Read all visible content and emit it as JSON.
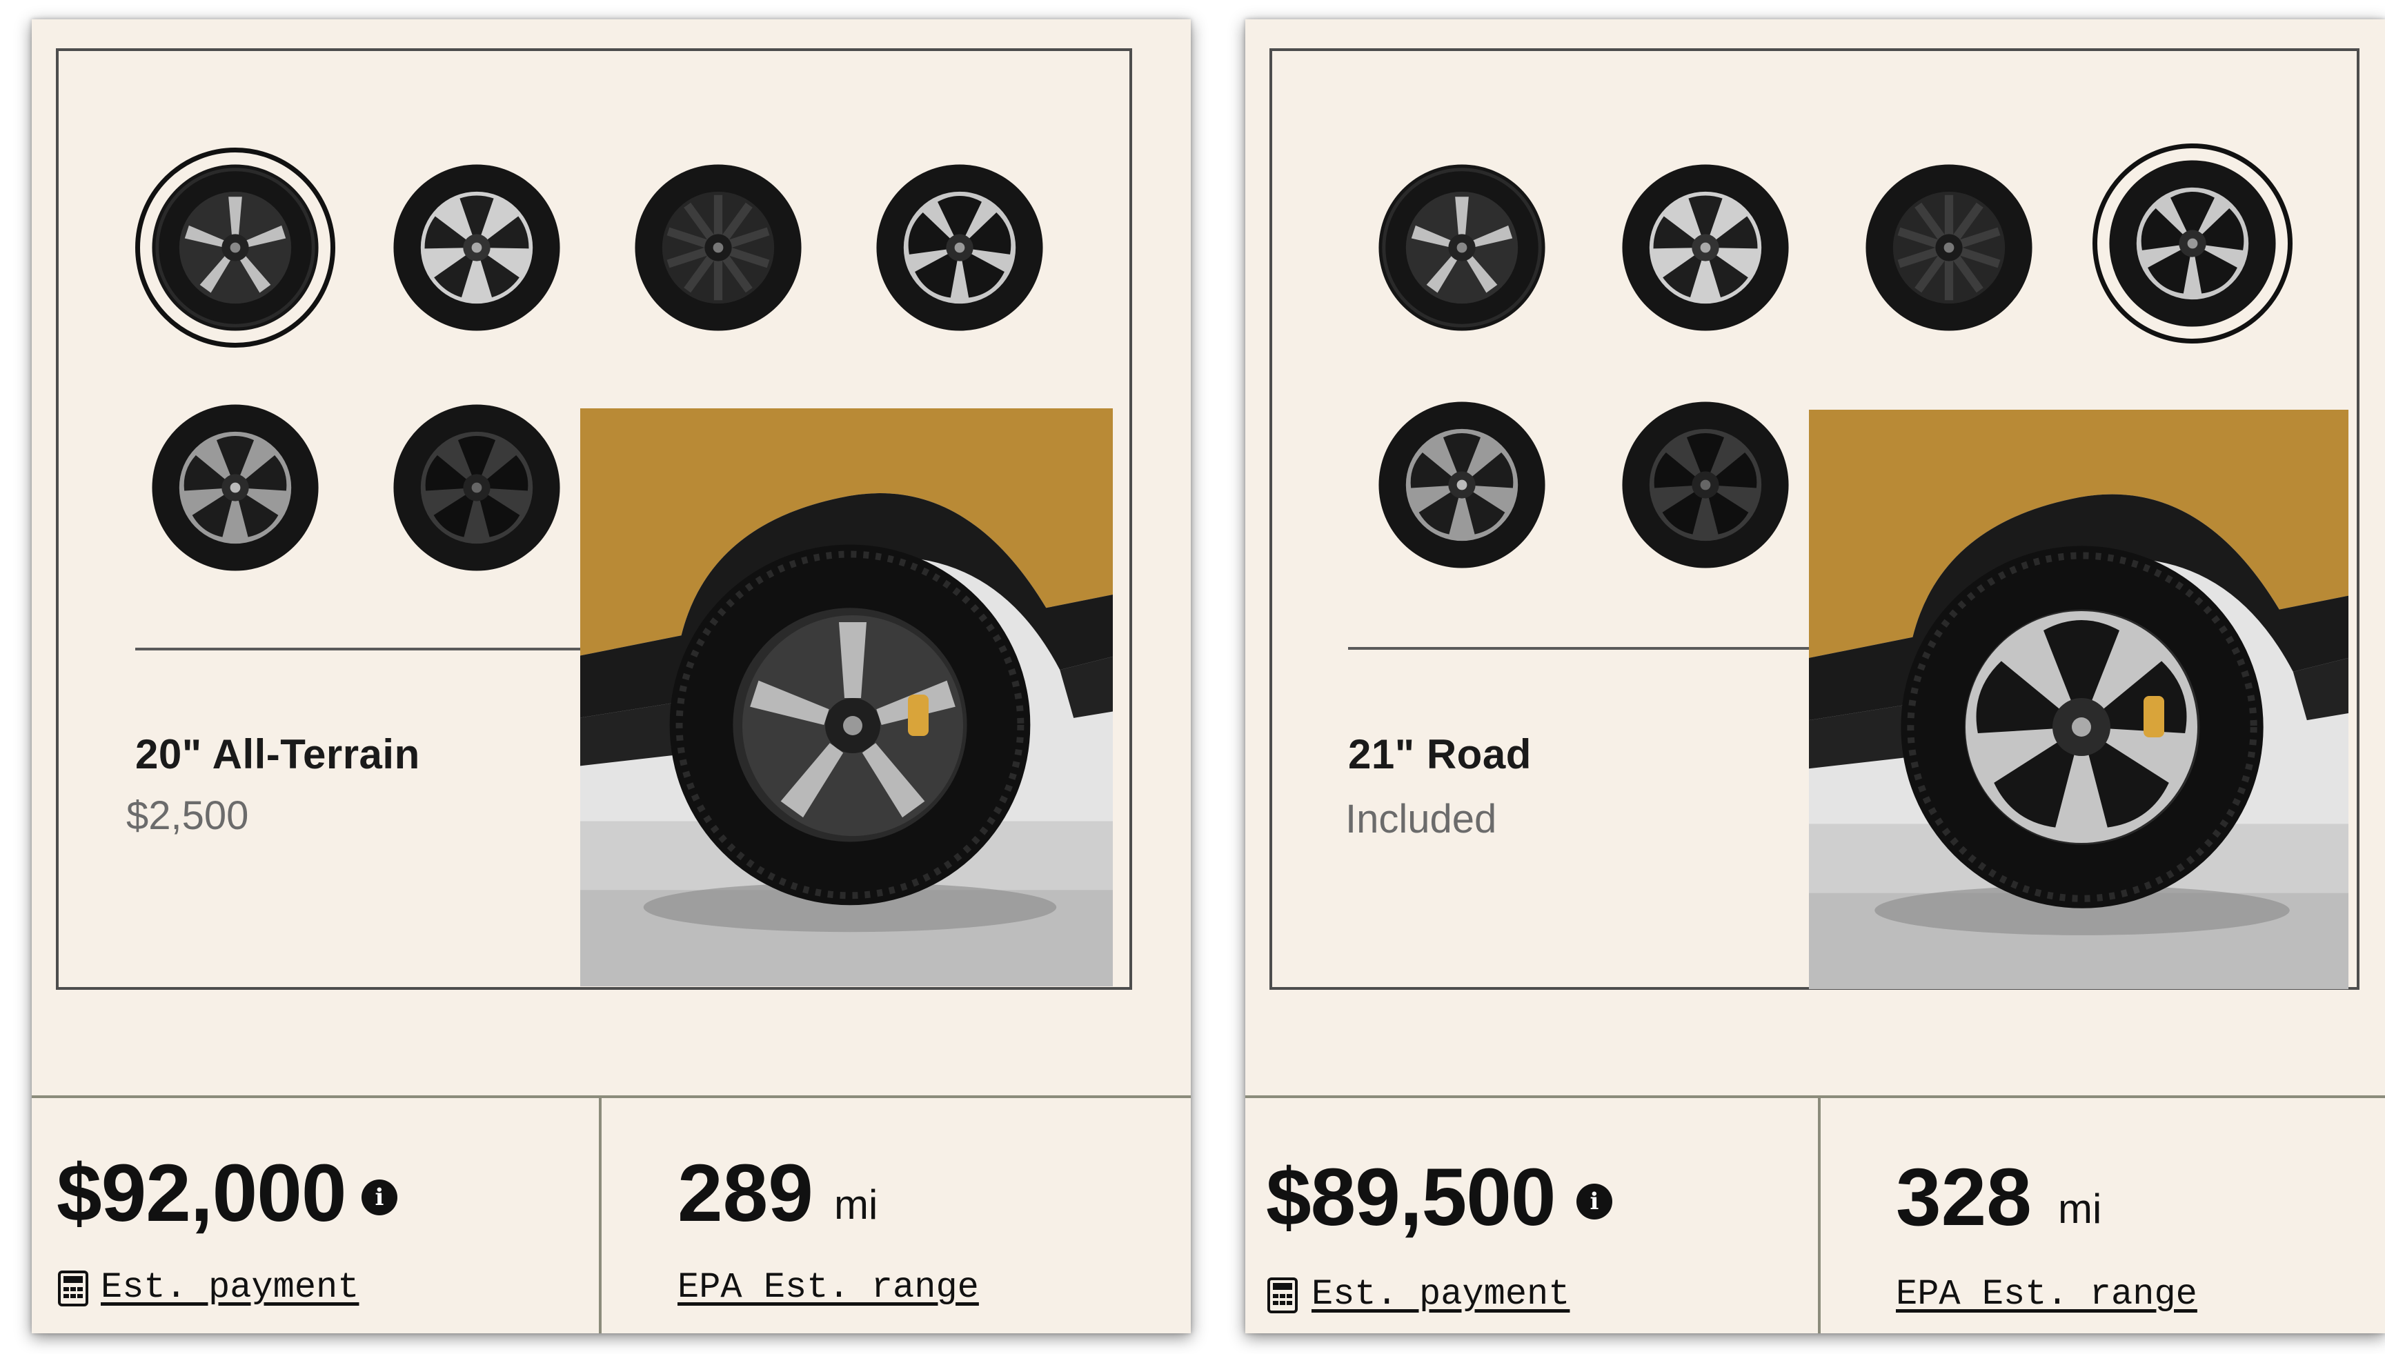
{
  "colors": {
    "panel_bg": "#f7f0e7",
    "frame_border": "#4d4d4d",
    "vehicle_body": "#b98a36",
    "text_primary": "#111111",
    "text_muted": "#6b6b6b"
  },
  "left": {
    "wheel_title": "20\" All-Terrain",
    "wheel_price": "$2,500",
    "selected_wheel": 1,
    "wheel_options": [
      "wheel-1",
      "wheel-2",
      "wheel-3",
      "wheel-4",
      "wheel-5",
      "wheel-6"
    ],
    "price": "$92,000",
    "payment_label": "Est. payment",
    "range_value": "289",
    "range_unit": "mi",
    "range_label": "EPA Est. range"
  },
  "right": {
    "wheel_title": "21\" Road",
    "wheel_price": "Included",
    "selected_wheel": 4,
    "wheel_options": [
      "wheel-1",
      "wheel-2",
      "wheel-3",
      "wheel-4",
      "wheel-5",
      "wheel-6"
    ],
    "price": "$89,500",
    "payment_label": "Est. payment",
    "range_value": "328",
    "range_unit": "mi",
    "range_label": "EPA Est. range"
  },
  "icons": {
    "info": "info-icon",
    "calculator": "calculator-icon",
    "info_glyph": "i"
  }
}
